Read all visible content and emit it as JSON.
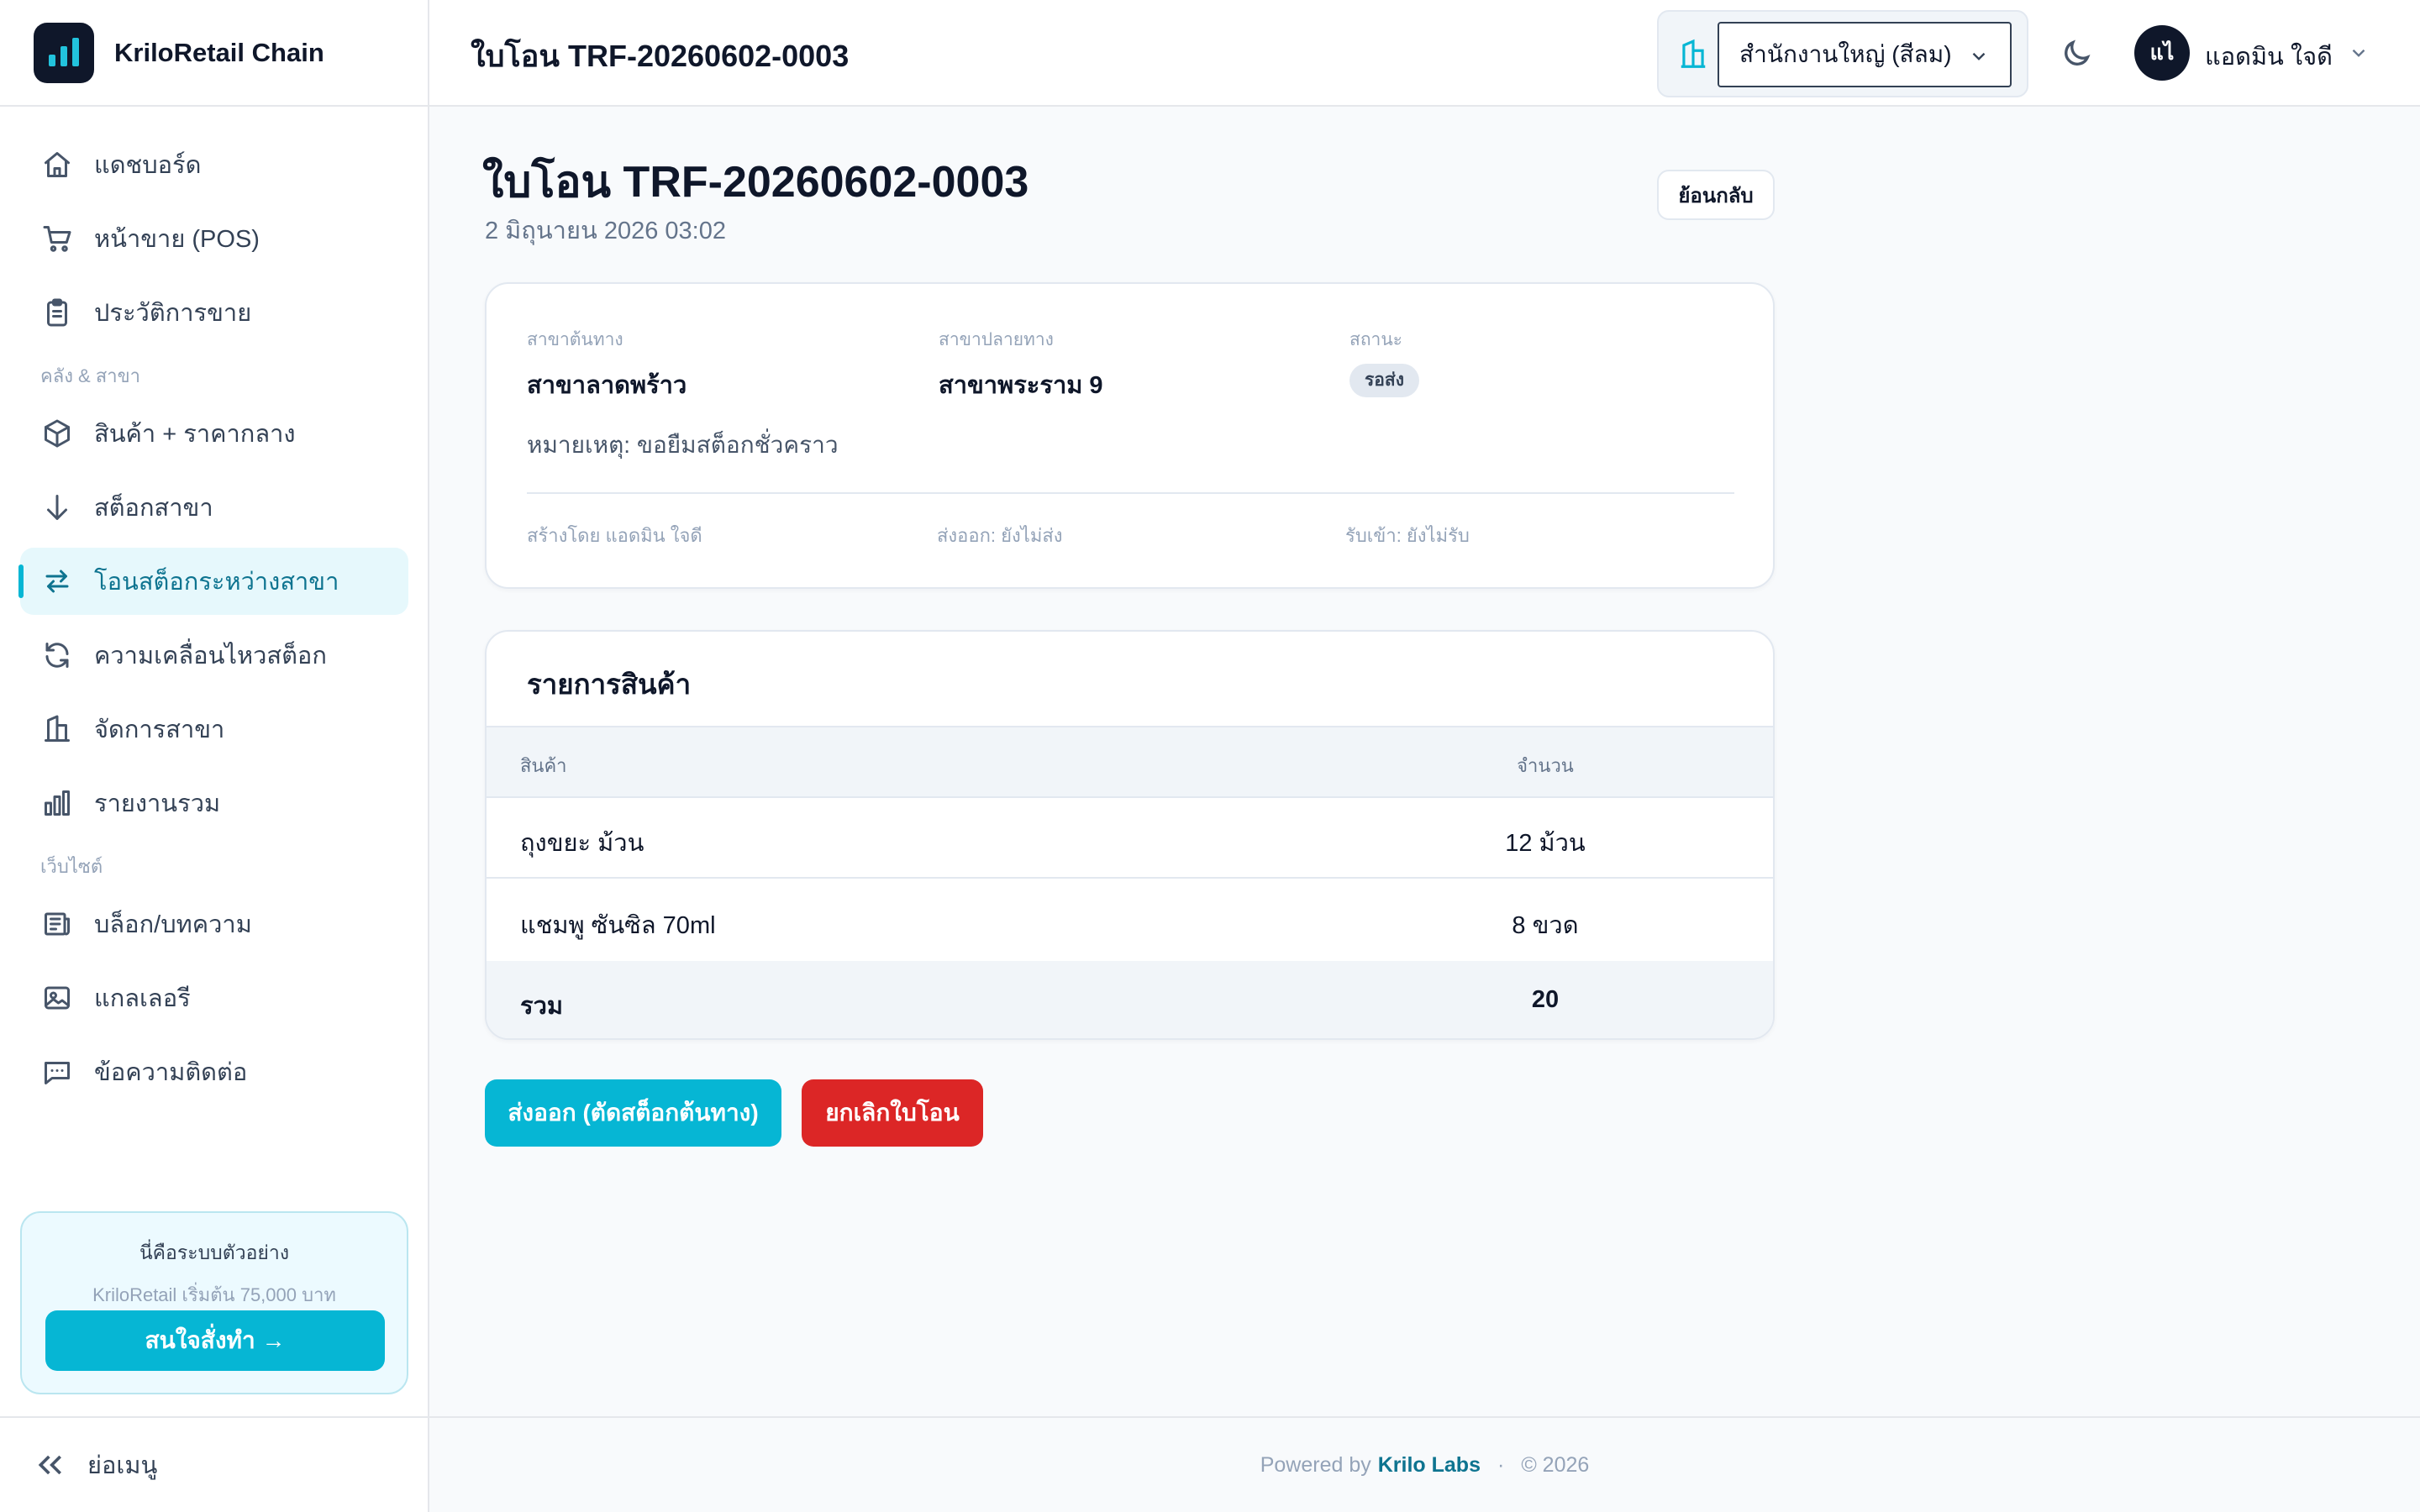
{
  "app": {
    "name": "KriloRetail Chain"
  },
  "sidebar": {
    "items_main": [
      {
        "label": "แดชบอร์ด",
        "icon": "home-icon"
      },
      {
        "label": "หน้าขาย (POS)",
        "icon": "cart-icon"
      },
      {
        "label": "ประวัติการขาย",
        "icon": "clipboard-icon"
      }
    ],
    "section_inventory": "คลัง & สาขา",
    "items_inventory": [
      {
        "label": "สินค้า + ราคากลาง",
        "icon": "box-icon"
      },
      {
        "label": "สต็อกสาขา",
        "icon": "arrow-down-icon"
      },
      {
        "label": "โอนสต็อกระหว่างสาขา",
        "icon": "transfer-icon",
        "active": true
      },
      {
        "label": "ความเคลื่อนไหวสต็อก",
        "icon": "refresh-icon"
      },
      {
        "label": "จัดการสาขา",
        "icon": "building-icon"
      },
      {
        "label": "รายงานรวม",
        "icon": "bar-chart-icon"
      }
    ],
    "section_website": "เว็บไซต์",
    "items_website": [
      {
        "label": "บล็อก/บทความ",
        "icon": "newspaper-icon"
      },
      {
        "label": "แกลเลอรี",
        "icon": "image-icon"
      },
      {
        "label": "ข้อความติดต่อ",
        "icon": "message-icon"
      }
    ],
    "promo": {
      "line1": "นี่คือระบบตัวอย่าง",
      "line2": "KriloRetail เริ่มต้น 75,000 บาท",
      "button": "สนใจสั่งทำ →"
    },
    "collapse_label": "ย่อเมนู"
  },
  "header": {
    "title": "ใบโอน TRF-20260602-0003",
    "branch_selected": "สำนักงานใหญ่ (สีลม)",
    "user_initials": "แไ",
    "user_name": "แอดมิน ใจดี"
  },
  "page": {
    "title": "ใบโอน TRF-20260602-0003",
    "date": "2 มิถุนายน 2026 03:02",
    "back_label": "ย้อนกลับ"
  },
  "info": {
    "from_label": "สาขาต้นทาง",
    "from_value": "สาขาลาดพร้าว",
    "to_label": "สาขาปลายทาง",
    "to_value": "สาขาพระราม 9",
    "status_label": "สถานะ",
    "status_value": "รอส่ง",
    "note": "หมายเหตุ: ขอยืมสต็อกชั่วคราว",
    "created_by": "สร้างโดย แอดมิน ใจดี",
    "shipped": "ส่งออก: ยังไม่ส่ง",
    "received": "รับเข้า: ยังไม่รับ"
  },
  "items": {
    "title": "รายการสินค้า",
    "col_product": "สินค้า",
    "col_qty": "จำนวน",
    "rows": [
      {
        "product": "ถุงขยะ ม้วน",
        "qty": "12 ม้วน"
      },
      {
        "product": "แชมพู ซันซิล 70ml",
        "qty": "8 ขวด"
      }
    ],
    "total_label": "รวม",
    "total_value": "20"
  },
  "actions": {
    "ship": "ส่งออก (ตัดสต็อกต้นทาง)",
    "cancel": "ยกเลิกใบโอน"
  },
  "footer": {
    "powered": "Powered by",
    "brand": "Krilo Labs",
    "dot": "·",
    "year": "© 2026"
  },
  "colors": {
    "accent": "#06b6d4",
    "danger": "#dc2626",
    "active_bg": "#e6f8fc",
    "dark": "#0f172a"
  }
}
